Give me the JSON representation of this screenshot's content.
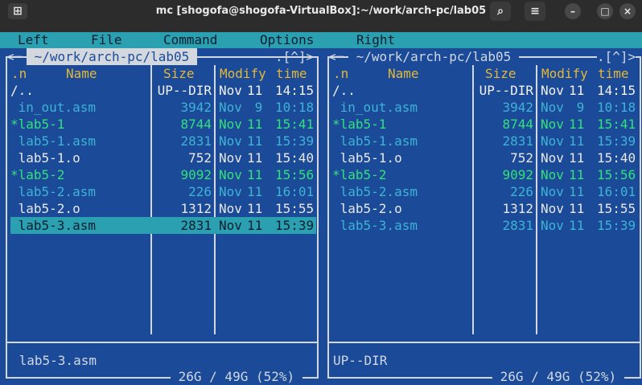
{
  "window": {
    "title": "mc [shogofa@shogofa-VirtualBox]:~/work/arch-pc/lab05",
    "new_tab_icon": "new-tab-icon",
    "controls": [
      "search-icon",
      "hamburger-menu-icon",
      "minimize-icon",
      "maximize-icon",
      "close-icon"
    ],
    "glyphs": {
      "newtab": "⊞",
      "search": "⌕",
      "menu": "≡",
      "min": "–",
      "max": "□",
      "close": "×"
    }
  },
  "menu": {
    "items": [
      "Left",
      "File",
      "Command",
      "Options",
      "Right"
    ]
  },
  "panels": {
    "left": {
      "path": " ~/work/arch-pc/lab05 ",
      "corner_left": "<─",
      "corner_right": ".[^]>",
      "headers": {
        "name_sort": ".n",
        "name": "Name",
        "size": "Size",
        "modify": "Modify",
        "time": "time"
      },
      "files": [
        {
          "name": "/..",
          "size": "UP--DIR",
          "month": "Nov",
          "day": "11",
          "time": "14:15",
          "kind": "dir"
        },
        {
          "name": " in_out.asm",
          "size": "3942",
          "month": "Nov",
          "day": " 9",
          "time": "10:18",
          "kind": "src"
        },
        {
          "name": "*lab5-1",
          "size": "8744",
          "month": "Nov",
          "day": "11",
          "time": "15:41",
          "kind": "exec"
        },
        {
          "name": " lab5-1.asm",
          "size": "2831",
          "month": "Nov",
          "day": "11",
          "time": "15:39",
          "kind": "src"
        },
        {
          "name": " lab5-1.o",
          "size": "752",
          "month": "Nov",
          "day": "11",
          "time": "15:40",
          "kind": "obj"
        },
        {
          "name": "*lab5-2",
          "size": "9092",
          "month": "Nov",
          "day": "11",
          "time": "15:56",
          "kind": "exec"
        },
        {
          "name": " lab5-2.asm",
          "size": "226",
          "month": "Nov",
          "day": "11",
          "time": "16:01",
          "kind": "src"
        },
        {
          "name": " lab5-2.o",
          "size": "1312",
          "month": "Nov",
          "day": "11",
          "time": "15:55",
          "kind": "obj"
        },
        {
          "name": " lab5-3.asm",
          "size": "2831",
          "month": "Nov",
          "day": "11",
          "time": "15:39",
          "kind": "src",
          "selected": true
        }
      ],
      "status": " lab5-3.asm",
      "disk": " 26G / 49G (52%) "
    },
    "right": {
      "path": " ~/work/arch-pc/lab05 ",
      "corner_left": "<─",
      "corner_right": ".[^]>",
      "headers": {
        "name_sort": ".n",
        "name": "Name",
        "size": "Size",
        "modify": "Modify",
        "time": "time"
      },
      "files": [
        {
          "name": "/..",
          "size": "UP--DIR",
          "month": "Nov",
          "day": "11",
          "time": "14:15",
          "kind": "dir"
        },
        {
          "name": " in_out.asm",
          "size": "3942",
          "month": "Nov",
          "day": " 9",
          "time": "10:18",
          "kind": "src"
        },
        {
          "name": "*lab5-1",
          "size": "8744",
          "month": "Nov",
          "day": "11",
          "time": "15:41",
          "kind": "exec"
        },
        {
          "name": " lab5-1.asm",
          "size": "2831",
          "month": "Nov",
          "day": "11",
          "time": "15:39",
          "kind": "src"
        },
        {
          "name": " lab5-1.o",
          "size": "752",
          "month": "Nov",
          "day": "11",
          "time": "15:40",
          "kind": "obj"
        },
        {
          "name": "*lab5-2",
          "size": "9092",
          "month": "Nov",
          "day": "11",
          "time": "15:56",
          "kind": "exec"
        },
        {
          "name": " lab5-2.asm",
          "size": "226",
          "month": "Nov",
          "day": "11",
          "time": "16:01",
          "kind": "src"
        },
        {
          "name": " lab5-2.o",
          "size": "1312",
          "month": "Nov",
          "day": "11",
          "time": "15:55",
          "kind": "obj"
        },
        {
          "name": " lab5-3.asm",
          "size": "2831",
          "month": "Nov",
          "day": "11",
          "time": "15:39",
          "kind": "src"
        }
      ],
      "status": "UP--DIR",
      "disk": " 26G / 49G (52%) "
    }
  }
}
